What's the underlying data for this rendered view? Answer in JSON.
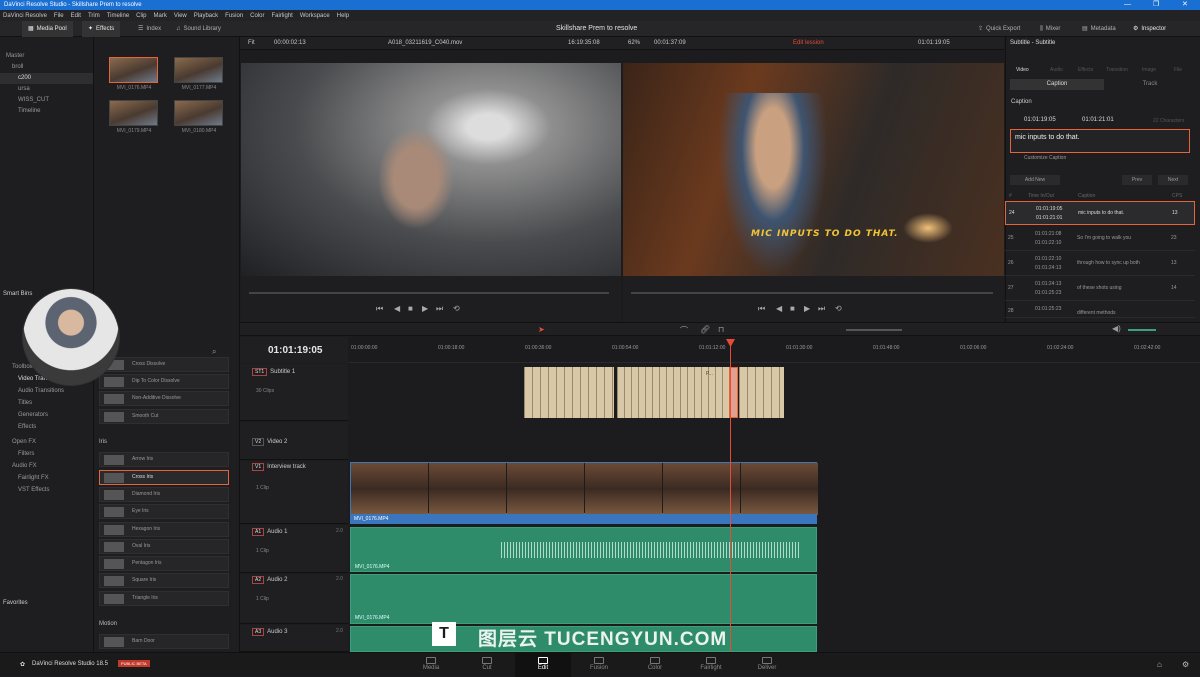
{
  "window": {
    "title": "DaVinci Resolve Studio - Skillshare Prem to resolve"
  },
  "menu": [
    "DaVinci Resolve",
    "File",
    "Edit",
    "Trim",
    "Timeline",
    "Clip",
    "Mark",
    "View",
    "Playback",
    "Fusion",
    "Color",
    "Fairlight",
    "Workspace",
    "Help"
  ],
  "toolbar": {
    "media_pool": "Media Pool",
    "effects": "Effects",
    "index": "Index",
    "sound_library": "Sound Library",
    "project_title": "Skillshare Prem to resolve",
    "quick_export": "Quick Export",
    "mixer": "Mixer",
    "metadata": "Metadata",
    "inspector": "Inspector"
  },
  "viewer_bar": {
    "fit": "Fit",
    "src_tc": "00:00:02:13",
    "clip_name": "A018_03211619_C040.mov",
    "src_dur": "16:19:35:08",
    "zoom": "62%",
    "rec_dur": "00:01:37:09",
    "timeline_name": "Edit lession",
    "rec_tc": "01:01:19:05",
    "inspector_title": "Subtitle - Subtitle"
  },
  "bins": {
    "master": "Master",
    "items": [
      "broll",
      "c200",
      "ursa",
      "WISS_CUT",
      "Timeline"
    ],
    "smart_bins": "Smart Bins",
    "favorites": "Favorites"
  },
  "media": [
    {
      "name": "MVI_0176.MP4"
    },
    {
      "name": "MVI_0177.MP4"
    },
    {
      "name": "MVI_0179.MP4"
    },
    {
      "name": "MVI_0180.MP4"
    }
  ],
  "effects_nav": [
    "Toolbox",
    "Video Transitions",
    "Audio Transitions",
    "Titles",
    "Generators",
    "Effects",
    "Open FX",
    "Filters",
    "Audio FX",
    "Fairlight FX",
    "VST Effects"
  ],
  "effects_list": {
    "dissolves": [
      "Cross Dissolve",
      "Dip To Color Dissolve",
      "Non-Additive Dissolve",
      "Smooth Cut"
    ],
    "iris_header": "Iris",
    "iris": [
      "Arrow Iris",
      "Cross Iris",
      "Diamond Iris",
      "Eye Iris",
      "Hexagon Iris",
      "Oval Iris",
      "Pentagon Iris",
      "Square Iris",
      "Triangle Iris"
    ],
    "motion_header": "Motion",
    "motion": [
      "Barn Door"
    ]
  },
  "subtitle_overlay": "MIC INPUTS TO DO THAT.",
  "timeline": {
    "timecode": "01:01:19:05",
    "ruler": [
      "01:00:00:00",
      "01:00:18:00",
      "01:00:36:00",
      "01:00:54:00",
      "01:01:12:00",
      "01:01:30:00",
      "01:01:48:00",
      "01:02:06:00",
      "01:02:24:00",
      "01:02:42:00"
    ],
    "subtitle_clip_label": "P...",
    "tracks": [
      {
        "tag": "ST1",
        "name": "Subtitle 1",
        "info": "30 Clips"
      },
      {
        "tag": "V2",
        "name": "Video 2",
        "info": ""
      },
      {
        "tag": "V1",
        "name": "Interview track",
        "info": "1 Clip"
      },
      {
        "tag": "A1",
        "name": "Audio 1",
        "info": "1 Clip",
        "ch": "2.0"
      },
      {
        "tag": "A2",
        "name": "Audio 2",
        "info": "1 Clip",
        "ch": "2.0"
      },
      {
        "tag": "A3",
        "name": "Audio 3",
        "info": "",
        "ch": "2.0"
      }
    ],
    "clip_name": "MVI_0176.MP4"
  },
  "inspector": {
    "tabs": [
      "Video",
      "Audio",
      "Effects",
      "Transition",
      "Image",
      "File"
    ],
    "subtabs": [
      "Caption",
      "Track"
    ],
    "caption_header": "Caption",
    "in_tc": "01:01:19:05",
    "out_tc": "01:01:21:01",
    "chars": "22 Characters",
    "text": "mic inputs to do that.",
    "customize": "Customize Caption",
    "add_new": "Add New",
    "prev": "Prev",
    "next": "Next",
    "cols": [
      "#",
      "Time In/Out",
      "Caption",
      "CPS"
    ],
    "rows": [
      {
        "n": "24",
        "in": "01:01:19:05",
        "out": "01:01:21:01",
        "cap": "mic inputs to do that.",
        "cps": "13"
      },
      {
        "n": "25",
        "in": "01:01:21:08",
        "out": "01:01:22:10",
        "cap": "So I'm going to walk you",
        "cps": "23"
      },
      {
        "n": "26",
        "in": "01:01:22:10",
        "out": "01:01:24:13",
        "cap": "through how to sync up both",
        "cps": "13"
      },
      {
        "n": "27",
        "in": "01:01:24:13",
        "out": "01:01:25:23",
        "cap": "of these shots using",
        "cps": "14"
      },
      {
        "n": "28",
        "in": "01:01:25:23",
        "out": "",
        "cap": "different methods",
        "cps": ""
      }
    ]
  },
  "pages": [
    "Media",
    "Cut",
    "Edit",
    "Fusion",
    "Color",
    "Fairlight",
    "Deliver"
  ],
  "brand": {
    "name": "DaVinci Resolve Studio 18.5",
    "badge": "PUBLIC BETA"
  },
  "watermark": "图层云 TUCENGYUN.COM",
  "colors": {
    "accent": "#e6643b",
    "playhead": "#e84a3a",
    "video": "#3a76bd",
    "audio": "#2f8c6b",
    "subtitle": "#d8c8a8"
  }
}
